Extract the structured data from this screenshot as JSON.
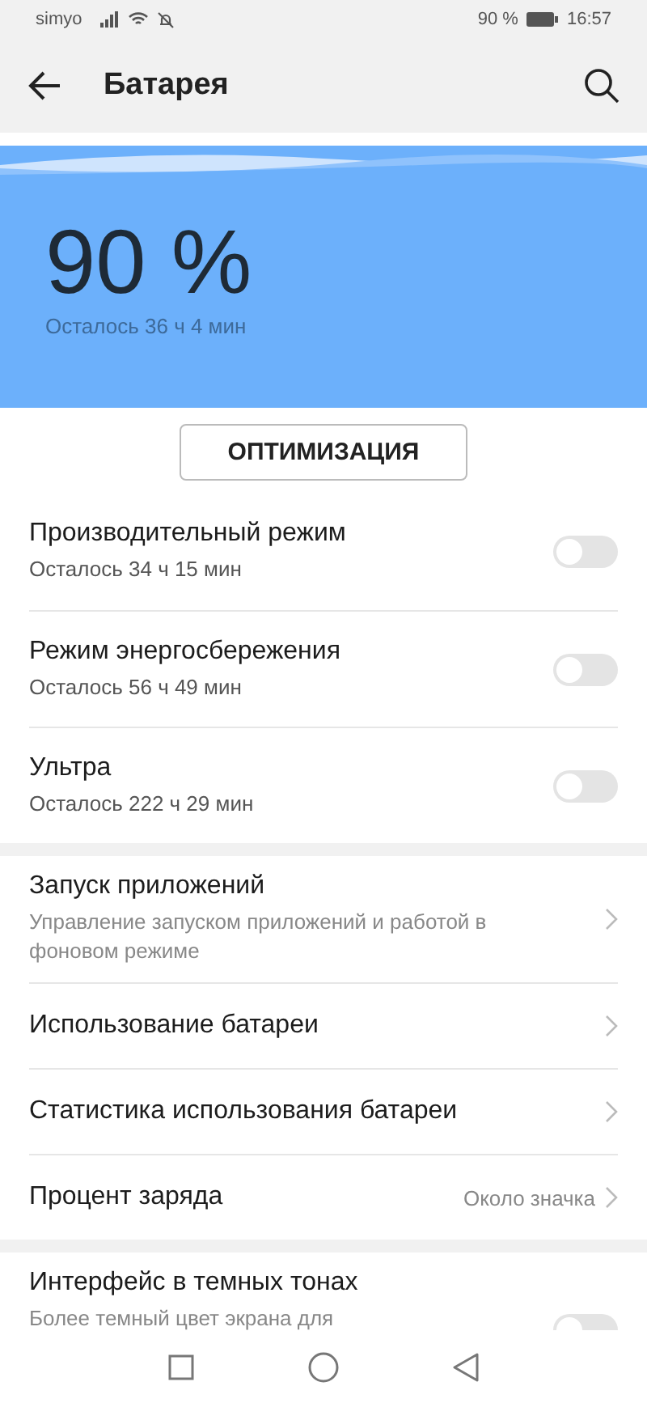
{
  "status_bar": {
    "carrier": "simyo",
    "battery_text": "90 %",
    "time": "16:57"
  },
  "header": {
    "title": "Батарея"
  },
  "hero": {
    "percent": "90 %",
    "remaining": "Осталось 36 ч 4 мин"
  },
  "optimize_button": "ОПТИМИЗАЦИЯ",
  "modes": [
    {
      "title": "Производительный режим",
      "subtitle": "Осталось 34 ч 15 мин",
      "on": false
    },
    {
      "title": "Режим энергосбережения",
      "subtitle": "Осталось 56 ч 49 мин",
      "on": false
    },
    {
      "title": "Ультра",
      "subtitle": "Осталось 222 ч 29 мин",
      "on": false
    }
  ],
  "settings": [
    {
      "title": "Запуск приложений",
      "subtitle": "Управление запуском приложений и работой в фоновом режиме"
    },
    {
      "title": "Использование батареи"
    },
    {
      "title": "Статистика использования батареи"
    },
    {
      "title": "Процент заряда",
      "value": "Около значка"
    }
  ],
  "dark_mode": {
    "title": "Интерфейс в темных тонах",
    "subtitle": "Более темный цвет экрана для",
    "on": false
  }
}
